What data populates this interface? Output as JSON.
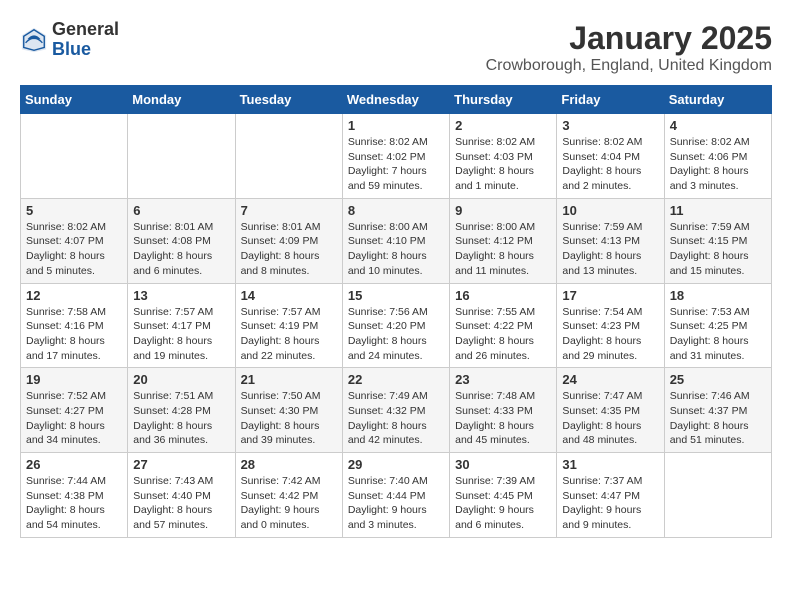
{
  "logo": {
    "general": "General",
    "blue": "Blue"
  },
  "title": "January 2025",
  "subtitle": "Crowborough, England, United Kingdom",
  "weekdays": [
    "Sunday",
    "Monday",
    "Tuesday",
    "Wednesday",
    "Thursday",
    "Friday",
    "Saturday"
  ],
  "weeks": [
    [
      {
        "day": "",
        "info": ""
      },
      {
        "day": "",
        "info": ""
      },
      {
        "day": "",
        "info": ""
      },
      {
        "day": "1",
        "info": "Sunrise: 8:02 AM\nSunset: 4:02 PM\nDaylight: 7 hours and 59 minutes."
      },
      {
        "day": "2",
        "info": "Sunrise: 8:02 AM\nSunset: 4:03 PM\nDaylight: 8 hours and 1 minute."
      },
      {
        "day": "3",
        "info": "Sunrise: 8:02 AM\nSunset: 4:04 PM\nDaylight: 8 hours and 2 minutes."
      },
      {
        "day": "4",
        "info": "Sunrise: 8:02 AM\nSunset: 4:06 PM\nDaylight: 8 hours and 3 minutes."
      }
    ],
    [
      {
        "day": "5",
        "info": "Sunrise: 8:02 AM\nSunset: 4:07 PM\nDaylight: 8 hours and 5 minutes."
      },
      {
        "day": "6",
        "info": "Sunrise: 8:01 AM\nSunset: 4:08 PM\nDaylight: 8 hours and 6 minutes."
      },
      {
        "day": "7",
        "info": "Sunrise: 8:01 AM\nSunset: 4:09 PM\nDaylight: 8 hours and 8 minutes."
      },
      {
        "day": "8",
        "info": "Sunrise: 8:00 AM\nSunset: 4:10 PM\nDaylight: 8 hours and 10 minutes."
      },
      {
        "day": "9",
        "info": "Sunrise: 8:00 AM\nSunset: 4:12 PM\nDaylight: 8 hours and 11 minutes."
      },
      {
        "day": "10",
        "info": "Sunrise: 7:59 AM\nSunset: 4:13 PM\nDaylight: 8 hours and 13 minutes."
      },
      {
        "day": "11",
        "info": "Sunrise: 7:59 AM\nSunset: 4:15 PM\nDaylight: 8 hours and 15 minutes."
      }
    ],
    [
      {
        "day": "12",
        "info": "Sunrise: 7:58 AM\nSunset: 4:16 PM\nDaylight: 8 hours and 17 minutes."
      },
      {
        "day": "13",
        "info": "Sunrise: 7:57 AM\nSunset: 4:17 PM\nDaylight: 8 hours and 19 minutes."
      },
      {
        "day": "14",
        "info": "Sunrise: 7:57 AM\nSunset: 4:19 PM\nDaylight: 8 hours and 22 minutes."
      },
      {
        "day": "15",
        "info": "Sunrise: 7:56 AM\nSunset: 4:20 PM\nDaylight: 8 hours and 24 minutes."
      },
      {
        "day": "16",
        "info": "Sunrise: 7:55 AM\nSunset: 4:22 PM\nDaylight: 8 hours and 26 minutes."
      },
      {
        "day": "17",
        "info": "Sunrise: 7:54 AM\nSunset: 4:23 PM\nDaylight: 8 hours and 29 minutes."
      },
      {
        "day": "18",
        "info": "Sunrise: 7:53 AM\nSunset: 4:25 PM\nDaylight: 8 hours and 31 minutes."
      }
    ],
    [
      {
        "day": "19",
        "info": "Sunrise: 7:52 AM\nSunset: 4:27 PM\nDaylight: 8 hours and 34 minutes."
      },
      {
        "day": "20",
        "info": "Sunrise: 7:51 AM\nSunset: 4:28 PM\nDaylight: 8 hours and 36 minutes."
      },
      {
        "day": "21",
        "info": "Sunrise: 7:50 AM\nSunset: 4:30 PM\nDaylight: 8 hours and 39 minutes."
      },
      {
        "day": "22",
        "info": "Sunrise: 7:49 AM\nSunset: 4:32 PM\nDaylight: 8 hours and 42 minutes."
      },
      {
        "day": "23",
        "info": "Sunrise: 7:48 AM\nSunset: 4:33 PM\nDaylight: 8 hours and 45 minutes."
      },
      {
        "day": "24",
        "info": "Sunrise: 7:47 AM\nSunset: 4:35 PM\nDaylight: 8 hours and 48 minutes."
      },
      {
        "day": "25",
        "info": "Sunrise: 7:46 AM\nSunset: 4:37 PM\nDaylight: 8 hours and 51 minutes."
      }
    ],
    [
      {
        "day": "26",
        "info": "Sunrise: 7:44 AM\nSunset: 4:38 PM\nDaylight: 8 hours and 54 minutes."
      },
      {
        "day": "27",
        "info": "Sunrise: 7:43 AM\nSunset: 4:40 PM\nDaylight: 8 hours and 57 minutes."
      },
      {
        "day": "28",
        "info": "Sunrise: 7:42 AM\nSunset: 4:42 PM\nDaylight: 9 hours and 0 minutes."
      },
      {
        "day": "29",
        "info": "Sunrise: 7:40 AM\nSunset: 4:44 PM\nDaylight: 9 hours and 3 minutes."
      },
      {
        "day": "30",
        "info": "Sunrise: 7:39 AM\nSunset: 4:45 PM\nDaylight: 9 hours and 6 minutes."
      },
      {
        "day": "31",
        "info": "Sunrise: 7:37 AM\nSunset: 4:47 PM\nDaylight: 9 hours and 9 minutes."
      },
      {
        "day": "",
        "info": ""
      }
    ]
  ]
}
